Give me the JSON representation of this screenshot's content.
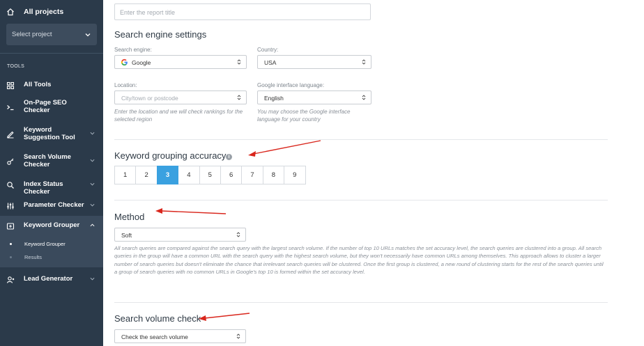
{
  "sidebar": {
    "all_projects": "All projects",
    "select_project": "Select project",
    "section_tools": "TOOLS",
    "items": [
      {
        "label": "All Tools",
        "icon": "grid-icon"
      },
      {
        "label": "On-Page SEO Checker",
        "icon": "terminal-icon"
      },
      {
        "label": "Keyword Suggestion Tool",
        "icon": "pencil-icon"
      },
      {
        "label": "Search Volume Checker",
        "icon": "key-icon"
      },
      {
        "label": "Index Status Checker",
        "icon": "search-icon"
      },
      {
        "label": "Parameter Checker",
        "icon": "sliders-icon"
      },
      {
        "label": "Keyword Grouper",
        "icon": "grouper-icon"
      },
      {
        "label": "Lead Generator",
        "icon": "user-icon"
      }
    ],
    "subitems": [
      "Keyword Grouper",
      "Results"
    ]
  },
  "main": {
    "report_title_placeholder": "Enter the report title",
    "search_engine_settings": "Search engine settings",
    "search_engine_label": "Search engine:",
    "search_engine_value": "Google",
    "country_label": "Country:",
    "country_value": "USA",
    "location_label": "Location:",
    "location_placeholder": "City/town or postcode",
    "location_hint": "Enter the location and we will check rankings for the selected region",
    "language_label": "Google interface language:",
    "language_value": "English",
    "language_hint": "You may choose the Google interface language for your country",
    "accuracy_heading": "Keyword grouping accuracy",
    "accuracy_levels": [
      "1",
      "2",
      "3",
      "4",
      "5",
      "6",
      "7",
      "8",
      "9"
    ],
    "accuracy_selected": "3",
    "method_heading": "Method",
    "method_value": "Soft",
    "method_description": "All search queries are compared against the search query with the largest search volume. If the number of top 10 URLs matches the set accuracy level, the search queries are clustered into a group. All search queries in the group will have a common URL with the search query with the highest search volume, but they won't necessarily have common URLs among themselves. This approach allows to cluster a larger number of search queries but doesn't eliminate the chance that irrelevant search queries will be clustered. Once the first group is clustered, a new round of clustering starts for the rest of the search queries until a group of search queries with no common URLs in Google's top 10 is formed within the set accuracy level.",
    "volume_heading": "Search volume check",
    "volume_value": "Check the search volume"
  },
  "colors": {
    "sidebar_bg": "#2b3a4a",
    "accent": "#3aa1e0",
    "arrow": "#d9261c"
  }
}
